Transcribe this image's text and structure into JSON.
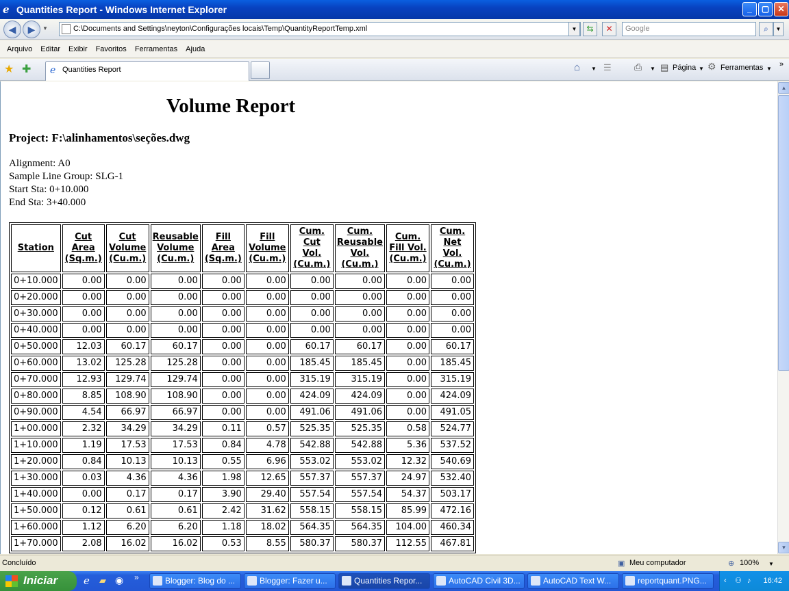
{
  "window": {
    "title": "Quantities Report - Windows Internet Explorer",
    "minimize": "_",
    "maximize": "▢",
    "close": "✕"
  },
  "address": {
    "url": "C:\\Documents and Settings\\neyton\\Configurações locais\\Temp\\QuantityReportTemp.xml",
    "search_placeholder": "Google"
  },
  "menu": [
    "Arquivo",
    "Editar",
    "Exibir",
    "Favoritos",
    "Ferramentas",
    "Ajuda"
  ],
  "tabs": {
    "active": "Quantities Report",
    "page_label": "Página",
    "tools_label": "Ferramentas"
  },
  "report": {
    "title": "Volume Report",
    "project": "Project:  F:\\alinhamentos\\seções.dwg",
    "alignment": "Alignment:  A0",
    "sample_line_group": "Sample Line Group:  SLG-1",
    "start_sta": "Start Sta:  0+10.000",
    "end_sta": "End Sta:  3+40.000",
    "columns": [
      "Station",
      "Cut Area (Sq.m.)",
      "Cut Volume (Cu.m.)",
      "Reusable Volume (Cu.m.)",
      "Fill Area (Sq.m.)",
      "Fill Volume (Cu.m.)",
      "Cum. Cut Vol. (Cu.m.)",
      "Cum. Reusable Vol. (Cu.m.)",
      "Cum. Fill Vol. (Cu.m.)",
      "Cum. Net Vol. (Cu.m.)"
    ],
    "rows": [
      [
        "0+10.000",
        "0.00",
        "0.00",
        "0.00",
        "0.00",
        "0.00",
        "0.00",
        "0.00",
        "0.00",
        "0.00"
      ],
      [
        "0+20.000",
        "0.00",
        "0.00",
        "0.00",
        "0.00",
        "0.00",
        "0.00",
        "0.00",
        "0.00",
        "0.00"
      ],
      [
        "0+30.000",
        "0.00",
        "0.00",
        "0.00",
        "0.00",
        "0.00",
        "0.00",
        "0.00",
        "0.00",
        "0.00"
      ],
      [
        "0+40.000",
        "0.00",
        "0.00",
        "0.00",
        "0.00",
        "0.00",
        "0.00",
        "0.00",
        "0.00",
        "0.00"
      ],
      [
        "0+50.000",
        "12.03",
        "60.17",
        "60.17",
        "0.00",
        "0.00",
        "60.17",
        "60.17",
        "0.00",
        "60.17"
      ],
      [
        "0+60.000",
        "13.02",
        "125.28",
        "125.28",
        "0.00",
        "0.00",
        "185.45",
        "185.45",
        "0.00",
        "185.45"
      ],
      [
        "0+70.000",
        "12.93",
        "129.74",
        "129.74",
        "0.00",
        "0.00",
        "315.19",
        "315.19",
        "0.00",
        "315.19"
      ],
      [
        "0+80.000",
        "8.85",
        "108.90",
        "108.90",
        "0.00",
        "0.00",
        "424.09",
        "424.09",
        "0.00",
        "424.09"
      ],
      [
        "0+90.000",
        "4.54",
        "66.97",
        "66.97",
        "0.00",
        "0.00",
        "491.06",
        "491.06",
        "0.00",
        "491.05"
      ],
      [
        "1+00.000",
        "2.32",
        "34.29",
        "34.29",
        "0.11",
        "0.57",
        "525.35",
        "525.35",
        "0.58",
        "524.77"
      ],
      [
        "1+10.000",
        "1.19",
        "17.53",
        "17.53",
        "0.84",
        "4.78",
        "542.88",
        "542.88",
        "5.36",
        "537.52"
      ],
      [
        "1+20.000",
        "0.84",
        "10.13",
        "10.13",
        "0.55",
        "6.96",
        "553.02",
        "553.02",
        "12.32",
        "540.69"
      ],
      [
        "1+30.000",
        "0.03",
        "4.36",
        "4.36",
        "1.98",
        "12.65",
        "557.37",
        "557.37",
        "24.97",
        "532.40"
      ],
      [
        "1+40.000",
        "0.00",
        "0.17",
        "0.17",
        "3.90",
        "29.40",
        "557.54",
        "557.54",
        "54.37",
        "503.17"
      ],
      [
        "1+50.000",
        "0.12",
        "0.61",
        "0.61",
        "2.42",
        "31.62",
        "558.15",
        "558.15",
        "85.99",
        "472.16"
      ],
      [
        "1+60.000",
        "1.12",
        "6.20",
        "6.20",
        "1.18",
        "18.02",
        "564.35",
        "564.35",
        "104.00",
        "460.34"
      ],
      [
        "1+70.000",
        "2.08",
        "16.02",
        "16.02",
        "0.53",
        "8.55",
        "580.37",
        "580.37",
        "112.55",
        "467.81"
      ]
    ]
  },
  "status": {
    "left": "Concluído",
    "zone": "Meu computador",
    "zoom": "100%"
  },
  "taskbar": {
    "start": "Iniciar",
    "tasks": [
      "Blogger: Blog do ...",
      "Blogger: Fazer u...",
      "Quantities Repor...",
      "AutoCAD Civil 3D...",
      "AutoCAD Text W...",
      "reportquant.PNG..."
    ],
    "clock": "16:42"
  }
}
